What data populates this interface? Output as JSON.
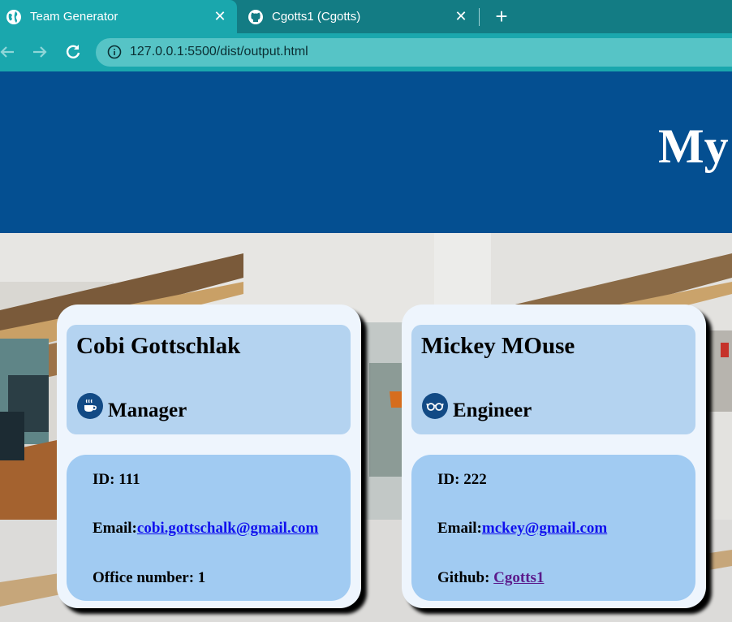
{
  "browser": {
    "tabs": [
      {
        "title": "Team Generator",
        "icon": "globe-icon",
        "active": true
      },
      {
        "title": "Cgotts1 (Cgotts)",
        "icon": "github-icon",
        "active": false
      }
    ],
    "close_symbol": "✕",
    "new_tab_symbol": "+",
    "url": "127.0.0.1:5500/dist/output.html"
  },
  "page": {
    "header_title": "My"
  },
  "cards": [
    {
      "name": "Cobi Gottschlak",
      "role": "Manager",
      "role_icon": "coffee-cup-icon",
      "id_label": "ID: 111",
      "email_label": "Email:",
      "email": "cobi.gottschalk@gmail.com",
      "extra_label": "Office number: 1",
      "extra_link": ""
    },
    {
      "name": "Mickey MOuse",
      "role": "Engineer",
      "role_icon": "glasses-icon",
      "id_label": "ID: 222",
      "email_label": "Email:",
      "email": "mckey@gmail.com",
      "extra_label": "Github: ",
      "extra_link": "Cgotts1"
    }
  ],
  "colors": {
    "tab_strip": "#137c84",
    "toolbar": "#1aa7ad",
    "header": "#044f91",
    "card": "#eef5fd",
    "card_top": "#b4d3f0",
    "card_bottom": "#a1cbf2",
    "icon_circle": "#124a85"
  }
}
